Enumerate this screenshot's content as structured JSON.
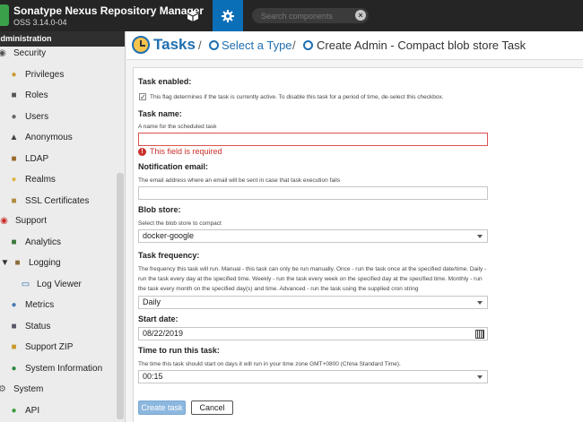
{
  "header": {
    "title": "Sonatype Nexus Repository Manager",
    "version": "OSS 3.14.0-04",
    "search": {
      "placeholder": "Search components",
      "value": ""
    },
    "clear_glyph": "×",
    "icons": [
      "cube-icon",
      "gear-icon",
      "clear-search-icon"
    ]
  },
  "sidebar": {
    "heading": "Administration",
    "items": [
      {
        "label": "Security",
        "icon": "shield-icon"
      },
      {
        "label": "Privileges",
        "icon": "medal-icon"
      },
      {
        "label": "Roles",
        "icon": "user-card-icon"
      },
      {
        "label": "Users",
        "icon": "users-icon"
      },
      {
        "label": "Anonymous",
        "icon": "anonymous-icon"
      },
      {
        "label": "LDAP",
        "icon": "book-icon"
      },
      {
        "label": "Realms",
        "icon": "shield-icon"
      },
      {
        "label": "SSL Certificates",
        "icon": "certificate-icon"
      },
      {
        "label": "Support",
        "icon": "lifebuoy-icon"
      },
      {
        "label": "Analytics",
        "icon": "chart-icon"
      },
      {
        "label": "Logging",
        "icon": "folder-icon"
      },
      {
        "label": "Log Viewer",
        "icon": "document-icon"
      },
      {
        "label": "Metrics",
        "icon": "gauge-icon"
      },
      {
        "label": "Status",
        "icon": "status-icon"
      },
      {
        "label": "Support ZIP",
        "icon": "zip-icon"
      },
      {
        "label": "System Information",
        "icon": "info-icon"
      },
      {
        "label": "System",
        "icon": "gear-icon"
      },
      {
        "label": "API",
        "icon": "api-icon"
      }
    ]
  },
  "breadcrumb": {
    "root": "Tasks",
    "separator": "/",
    "step": "Select a Type",
    "current": "Create Admin - Compact blob store Task"
  },
  "form": {
    "enabled": {
      "label": "Task enabled:",
      "hint": "This flag determines if the task is currently active. To disable this task for a period of time, de-select this checkbox.",
      "checked": true,
      "check_glyph": "✓"
    },
    "name": {
      "label": "Task name:",
      "hint": "A name for the scheduled task",
      "value": "",
      "error": "This field is required",
      "error_glyph": "!"
    },
    "email": {
      "label": "Notification email:",
      "hint": "The email address where an email will be sent in case that task execution fails",
      "value": ""
    },
    "blob_store": {
      "label": "Blob store:",
      "hint": "Select the blob store to compact",
      "value": "docker-google"
    },
    "frequency": {
      "label": "Task frequency:",
      "hint": "The frequency this task will run. Manual - this task can only be run manually. Once - run the task once at the specified date/time. Daily - run the task every day at the specified time. Weekly - run the task every week on the specified day at the specified time. Monthly - run the task every month on the specified day(s) and time. Advanced - run the task using the supplied cron string",
      "value": "Daily"
    },
    "start_date": {
      "label": "Start date:",
      "value": "08/22/2019"
    },
    "time": {
      "label": "Time to run this task:",
      "hint": "The time this task should start on days it will run in your time zone GMT+0800 (China Standard Time).",
      "value": "00:15"
    },
    "buttons": {
      "create": "Create task",
      "cancel": "Cancel"
    }
  },
  "colors": {
    "header_bg": "#252525",
    "accent": "#0b6fb8",
    "error": "#c9302c",
    "create_button": "#8cb7de"
  }
}
